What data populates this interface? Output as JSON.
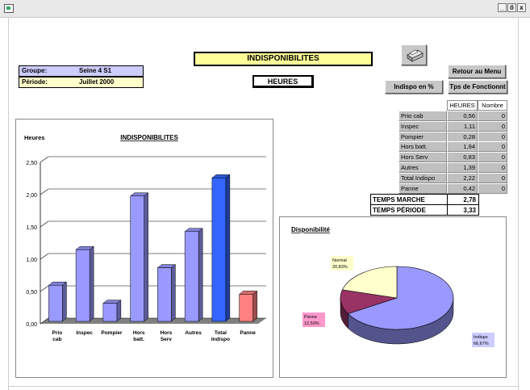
{
  "window": {
    "min_label": "_",
    "restore_label": "ő",
    "close_label": "x"
  },
  "header": {
    "title": "INDISPONIBILITES",
    "subtitle": "HEURES",
    "groupe_label": "Groupe:",
    "groupe_value": "Seine 4 S1",
    "periode_label": "Période:",
    "periode_value": "Juillet 2000"
  },
  "buttons": {
    "print_icon": "printer-icon",
    "retour": "Retour au Menu",
    "indispo_pct": "Indispo en %",
    "tps_fonct": "Tps de Fonctionnt"
  },
  "table": {
    "headers": [
      "HEURES",
      "Nombre"
    ],
    "rows": [
      {
        "name": "Prio cab",
        "heures": "0,56",
        "nombre": "0"
      },
      {
        "name": "Inspec",
        "heures": "1,11",
        "nombre": "0"
      },
      {
        "name": "Pompier",
        "heures": "0,28",
        "nombre": "0"
      },
      {
        "name": "Hors batt.",
        "heures": "1,94",
        "nombre": "0"
      },
      {
        "name": "Hors Serv",
        "heures": "0,83",
        "nombre": "0"
      },
      {
        "name": "Autres",
        "heures": "1,39",
        "nombre": "0"
      },
      {
        "name": "Total Indispo",
        "heures": "2,22",
        "nombre": "0"
      },
      {
        "name": "Panne",
        "heures": "0,42",
        "nombre": "0"
      }
    ],
    "temps_marche_label": "TEMPS MARCHE",
    "temps_marche_value": "2,78",
    "temps_periode_label": "TEMPS PÉRIODE",
    "temps_periode_value": "3,33"
  },
  "colors": {
    "bar": "#9999ff",
    "bar_total": "#3366ff",
    "bar_panne": "#ff8080",
    "pie_indispo": "#9999ff",
    "pie_panne": "#993366",
    "pie_normal": "#ffffcc"
  },
  "chart_data": [
    {
      "type": "bar",
      "title": "INDISPONIBILITES",
      "ylabel": "Heures",
      "categories": [
        "Prio cab",
        "Inspec",
        "Pompier",
        "Hors batt.",
        "Hors Serv",
        "Autres",
        "Total Indispo",
        "Panne"
      ],
      "values": [
        0.56,
        1.11,
        0.28,
        1.94,
        0.83,
        1.39,
        2.22,
        0.42
      ],
      "yticks": [
        "0,00",
        "0,50",
        "1,00",
        "1,50",
        "2,00",
        "2,50"
      ],
      "ylim": [
        0,
        2.5
      ],
      "grid": true
    },
    {
      "type": "pie",
      "title": "Disponibilité",
      "slices": [
        {
          "label": "Indispo",
          "value": 66.67,
          "text": "66,67%"
        },
        {
          "label": "Panne",
          "value": 12.5,
          "text": "12,50%"
        },
        {
          "label": "Normal",
          "value": 20.83,
          "text": "20,83%"
        }
      ]
    }
  ]
}
